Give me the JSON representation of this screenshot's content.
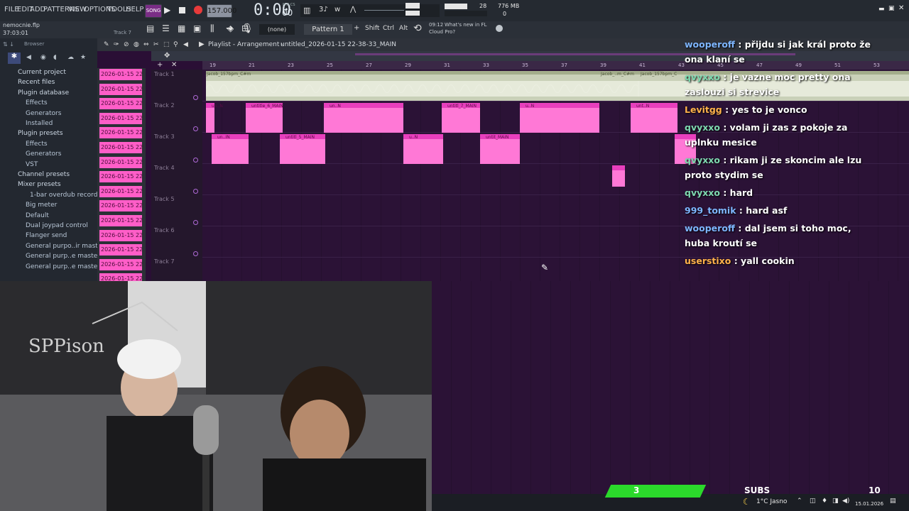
{
  "menu": [
    "FILE",
    "EDIT",
    "ADD",
    "PATTERNS",
    "VIEW",
    "OPTIONS",
    "TOOLS",
    "HELP"
  ],
  "transport": {
    "tempo": "157.000",
    "time": "0:00",
    "time_sub": "00",
    "time_label": "M:S:CS",
    "cpu": "28",
    "mem": "776 MB",
    "voices": "0"
  },
  "project": {
    "file": "nemocnie.flp",
    "position": "37:03:01",
    "track_hint": "Track 7"
  },
  "toolbar": {
    "pattern": "Pattern 1",
    "snap": "(none)",
    "shift": "Shift",
    "ctrl": "Ctrl",
    "alt": "Alt",
    "news_time": "09:12",
    "news_line1": "What's new in FL",
    "news_line2": "Cloud Pro?"
  },
  "browser": {
    "title": "Browser",
    "items": [
      {
        "label": "Current project",
        "indent": 0
      },
      {
        "label": "Recent files",
        "indent": 0
      },
      {
        "label": "Plugin database",
        "indent": 0
      },
      {
        "label": "Effects",
        "indent": 1
      },
      {
        "label": "Generators",
        "indent": 1
      },
      {
        "label": "Installed",
        "indent": 1
      },
      {
        "label": "Plugin presets",
        "indent": 0
      },
      {
        "label": "Effects",
        "indent": 1
      },
      {
        "label": "Generators",
        "indent": 1
      },
      {
        "label": "VST",
        "indent": 1
      },
      {
        "label": "Channel presets",
        "indent": 0
      },
      {
        "label": "Mixer presets",
        "indent": 0
      },
      {
        "label": "1-bar overdub recording",
        "indent": 2
      },
      {
        "label": "Big meter",
        "indent": 1
      },
      {
        "label": "Default",
        "indent": 1
      },
      {
        "label": "Dual joypad control",
        "indent": 1
      },
      {
        "label": "Flanger send",
        "indent": 1
      },
      {
        "label": "General purpo..ir mastering",
        "indent": 1
      },
      {
        "label": "General purp..e mastering 2",
        "indent": 1
      },
      {
        "label": "General purp..e mastering 3",
        "indent": 1
      }
    ]
  },
  "patterns": {
    "label": "2026-01-15 22-"
  },
  "playlist": {
    "title": "Playlist - Arrangement",
    "file": "untitled_2026-01-15 22-38-33_MAIN"
  },
  "ruler": [
    "19",
    "21",
    "23",
    "25",
    "27",
    "29",
    "31",
    "33",
    "35",
    "37",
    "39",
    "41",
    "43",
    "45",
    "47",
    "49",
    "51",
    "53",
    "54"
  ],
  "tracks": [
    "Track 1",
    "Track 2",
    "Track 3",
    "Track 4",
    "Track 5",
    "Track 6",
    "Track 7"
  ],
  "clips": {
    "audio": "Jacob_157bpm_C#m",
    "audio2": "Jacob_..m_C#m",
    "audio3": "Jacob_157bpm_C",
    "t2": [
      "un..N",
      "untitle_6_MAIN",
      "un..N",
      "untitl_7_MAIN",
      "u..N",
      "unt..N"
    ],
    "t3": [
      "un..IN",
      "untitl_5_MAIN",
      "u..N",
      "untit_MAIN"
    ]
  },
  "chat": [
    {
      "user": "wooperoff",
      "color": "#7eb6ff",
      "text": "přijdu si jak král proto že ona klaní se"
    },
    {
      "user": "qvyxxo",
      "color": "#7ed9b0",
      "text": "je vazne moc pretty ona zaslouzi si strevice"
    },
    {
      "user": "Levitgg",
      "color": "#ffb24a",
      "text": "yes to je vonco"
    },
    {
      "user": "qvyxxo",
      "color": "#7ed9b0",
      "text": "volam ji zas z pokoje za uplnku mesice"
    },
    {
      "user": "qvyxxo",
      "color": "#7ed9b0",
      "text": "rikam ji ze skoncim ale lzu proto stydim se"
    },
    {
      "user": "qvyxxo",
      "color": "#7ed9b0",
      "text": "hard"
    },
    {
      "user": "999_tomik",
      "color": "#7eb6ff",
      "text": "hard asf"
    },
    {
      "user": "wooperoff",
      "color": "#7eb6ff",
      "text": "dal jsem si toho moc, huba kroutí se"
    },
    {
      "user": "userstixo",
      "color": "#ffb24a",
      "text": "yall cookin"
    }
  ],
  "subs": {
    "count": "3",
    "label": "SUBS",
    "goal": "10"
  },
  "taskbar": {
    "weather": "1°C Jasno",
    "date": "15.01.2026"
  },
  "colors": {
    "accent": "#ff5ec8",
    "bg": "#2b1236",
    "chrome": "#252a31"
  }
}
